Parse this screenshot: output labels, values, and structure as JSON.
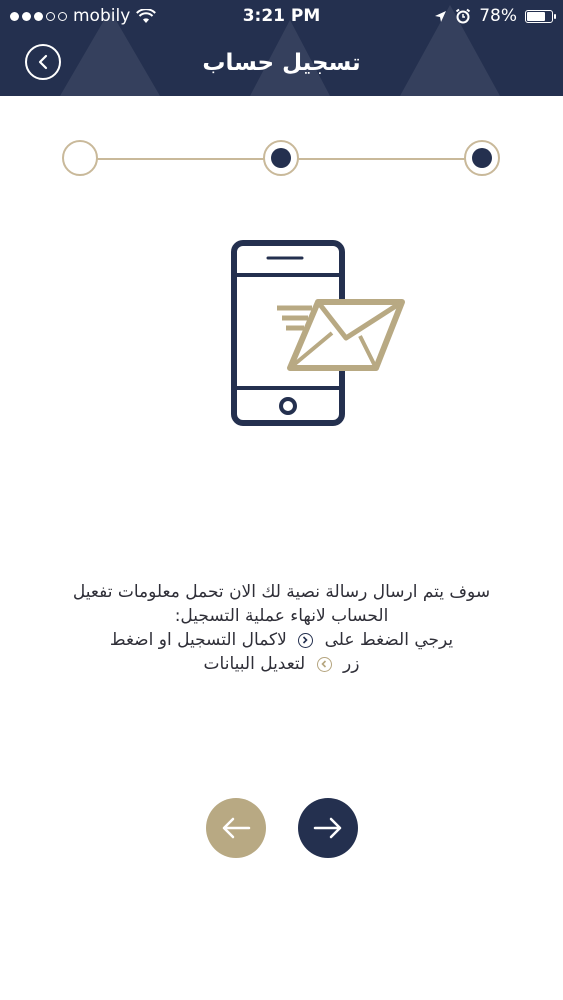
{
  "status_bar": {
    "carrier": "mobily",
    "time": "3:21 PM",
    "battery": "78%",
    "battery_level": 0.78,
    "signal_bars_filled": 3,
    "signal_bars_total": 5
  },
  "header": {
    "title": "تسجيل حساب",
    "back_icon": "chevron-left-icon"
  },
  "stepper": {
    "steps": [
      {
        "state": "pending"
      },
      {
        "state": "active"
      },
      {
        "state": "completed"
      }
    ]
  },
  "illustration": {
    "icon": "phone-envelope-icon"
  },
  "message": {
    "line1": "سوف يتم ارسال رسالة  نصية لك الان تحمل معلومات تفعيل",
    "line2": "الحساب لانهاء عملية التسجيل:",
    "line3_before": "يرجي الضغط على",
    "line3_after": "لاكمال التسجيل  او اضغط",
    "line4_before": "زر",
    "line4_after": "لتعديل البيانات"
  },
  "buttons": {
    "prev_icon": "arrow-left-icon",
    "next_icon": "arrow-right-icon"
  },
  "colors": {
    "primary": "#24304f",
    "accent": "#b8a983",
    "line": "#c9b99a"
  }
}
